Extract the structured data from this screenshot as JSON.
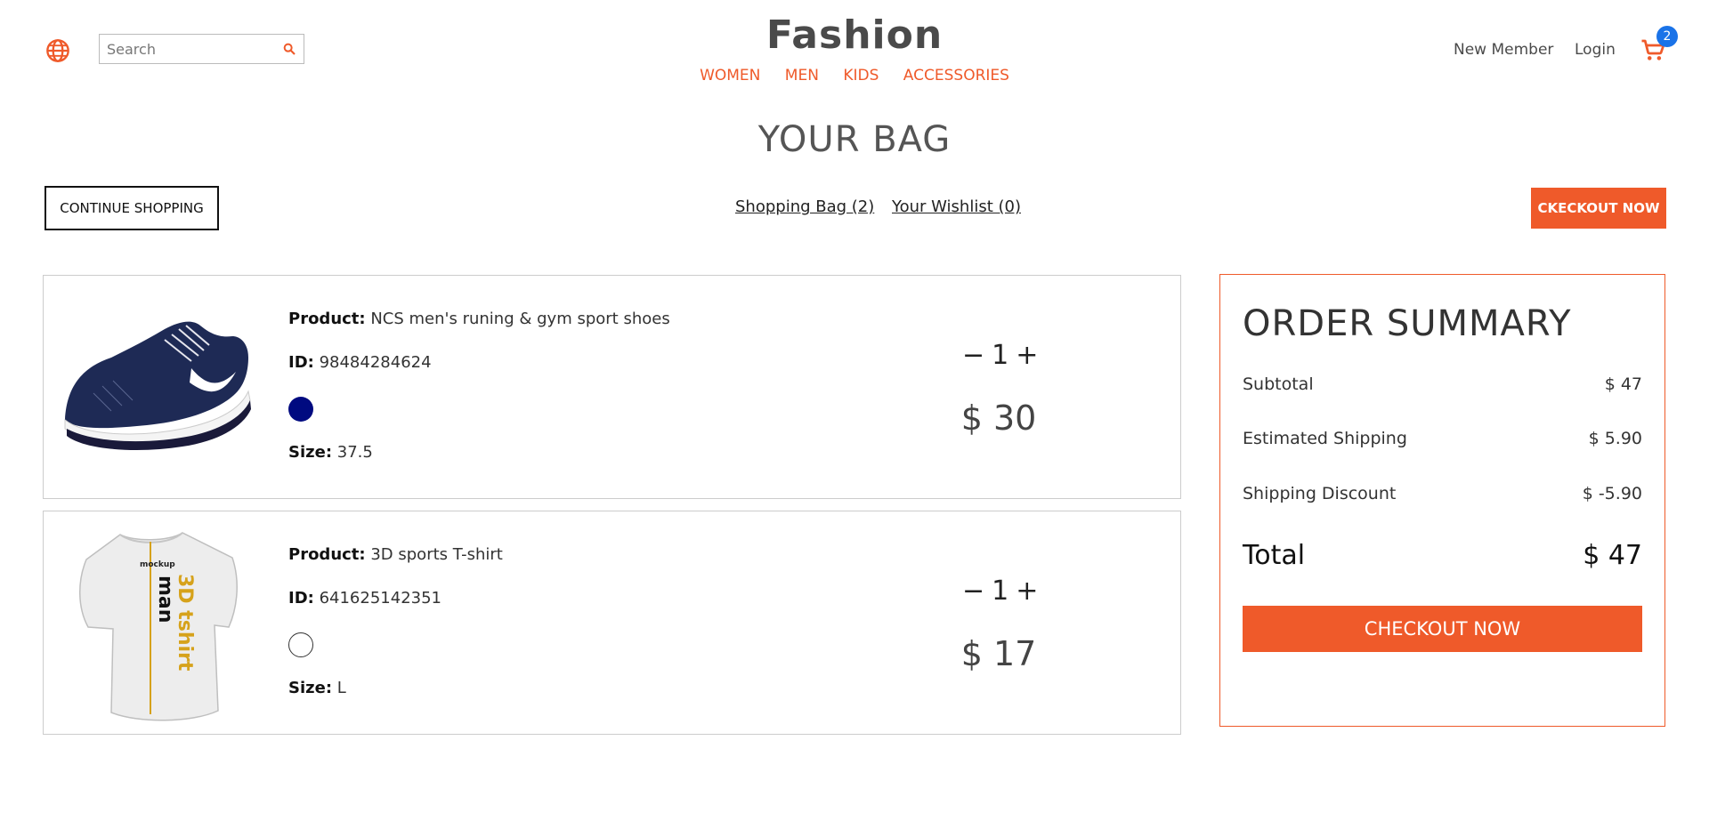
{
  "header": {
    "logo": "Fashion",
    "search_placeholder": "Search",
    "nav": [
      "WOMEN",
      "MEN",
      "KIDS",
      "ACCESSORIES"
    ],
    "new_member": "New Member",
    "login": "Login",
    "cart_count": "2",
    "icons": {
      "globe": "globe-icon",
      "search": "search-icon",
      "cart": "cart-icon"
    }
  },
  "page": {
    "title": "YOUR BAG",
    "continue_label": "CONTINUE SHOPPING",
    "tab_bag": "Shopping Bag (2)",
    "tab_wishlist": "Your Wishlist (0)",
    "checkout_top": "CKECKOUT NOW"
  },
  "items": [
    {
      "product_label": "Product:",
      "product": "NCS men's runing & gym sport shoes",
      "id_label": "ID:",
      "id": "98484284624",
      "color": "#000a80",
      "size_label": "Size:",
      "size": "37.5",
      "minus": "−",
      "qty": "1",
      "plus": "+",
      "price": "$ 30"
    },
    {
      "product_label": "Product:",
      "product": "3D sports T-shirt",
      "id_label": "ID:",
      "id": "641625142351",
      "color": "#ffffff",
      "size_label": "Size:",
      "size": "L",
      "minus": "−",
      "qty": "1",
      "plus": "+",
      "price": "$ 17",
      "image_text": [
        "mockup",
        "man",
        "3D tshirt"
      ]
    }
  ],
  "summary": {
    "title": "ORDER SUMMARY",
    "subtotal_label": "Subtotal",
    "subtotal": "$ 47",
    "shipping_label": "Estimated Shipping",
    "shipping": "$ 5.90",
    "discount_label": "Shipping Discount",
    "discount": "$ -5.90",
    "total_label": "Total",
    "total": "$ 47",
    "checkout": "CHECKOUT NOW"
  },
  "colors": {
    "accent": "#ef5a2a",
    "badge": "#1a73e8"
  }
}
